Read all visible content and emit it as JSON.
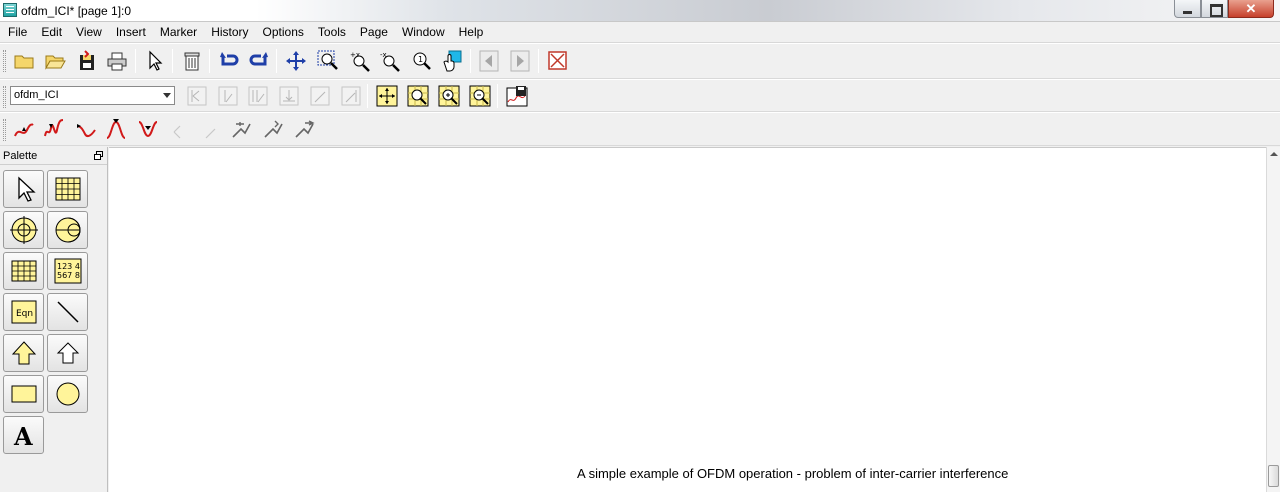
{
  "window": {
    "title": "ofdm_ICI* [page 1]:0",
    "close_glyph": "✕"
  },
  "menu": [
    "File",
    "Edit",
    "View",
    "Insert",
    "Marker",
    "History",
    "Options",
    "Tools",
    "Page",
    "Window",
    "Help"
  ],
  "toolbar2": {
    "document_select": "ofdm_ICI"
  },
  "palette": {
    "title": "Palette",
    "text_tool_glyph": "A",
    "eqn_label": "Eqn",
    "table_label_1": "123 4",
    "table_label_2": "567 8"
  },
  "canvas": {
    "caption": "A simple example of OFDM operation - problem of inter-carrier interference"
  },
  "colors": {
    "accent_yellow": "#fff49a",
    "undo_blue": "#1f3fa8",
    "marker_red": "#d11a1a",
    "delete_red": "#c0392b"
  }
}
